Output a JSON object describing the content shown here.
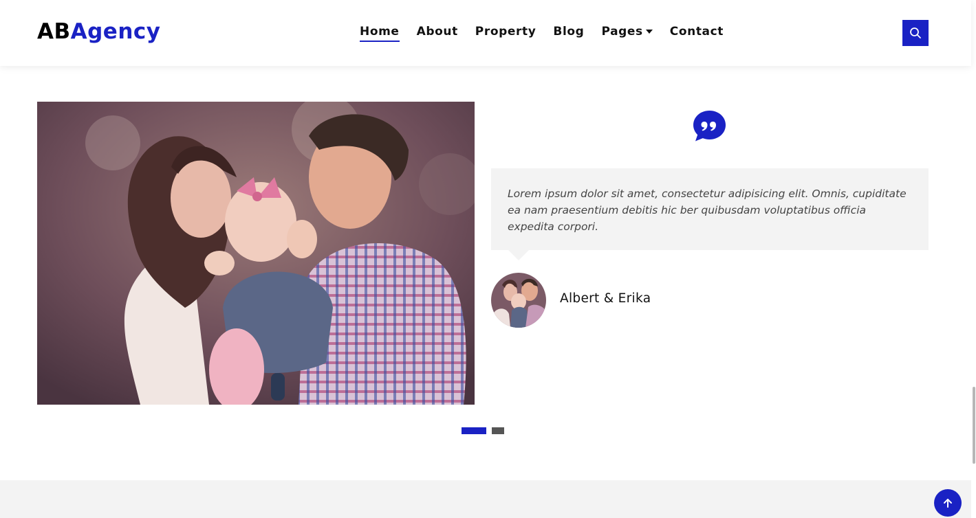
{
  "brand": {
    "part1": "AB",
    "part2": "Agency"
  },
  "nav": {
    "items": [
      {
        "label": "Home",
        "active": true
      },
      {
        "label": "About"
      },
      {
        "label": "Property"
      },
      {
        "label": "Blog"
      },
      {
        "label": "Pages",
        "dropdown": true
      },
      {
        "label": "Contact"
      }
    ]
  },
  "search": {
    "icon": "search-icon"
  },
  "testimonial": {
    "quote_icon": "quote-icon",
    "text": "Lorem ipsum dolor sit amet, consectetur adipisicing elit. Omnis, cupiditate ea nam praesentium debitis hic ber quibusdam voluptatibus officia expedita corpori.",
    "author": "Albert & Erika"
  },
  "carousel": {
    "count": 2,
    "active_index": 0
  },
  "back_to_top": {
    "icon": "arrow-up-icon"
  },
  "colors": {
    "accent": "#1a22c4",
    "quote_bg": "#f3f3f3",
    "footer_bg": "#f3f3f3"
  }
}
